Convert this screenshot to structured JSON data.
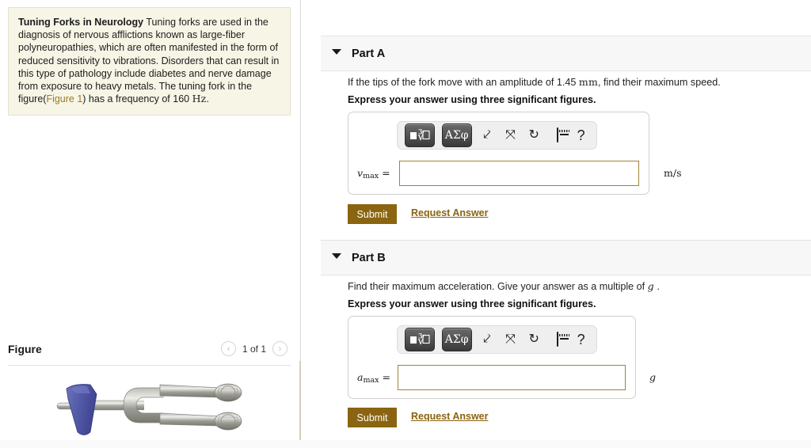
{
  "problem": {
    "title": "Tuning Forks in Neurology",
    "body_before_link": " Tuning forks are used in the diagnosis of nervous afflictions known as large-fiber polyneuropathies, which are often manifested in the form of reduced sensitivity to vibrations. Disorders that can result in this type of pathology include diabetes and nerve damage from exposure to heavy metals. The tuning fork in the figure(",
    "figure_link": "Figure 1",
    "body_after_link": ") has a frequency of 160 ",
    "frequency_unit": "Hz",
    "body_end": "."
  },
  "figure": {
    "title": "Figure",
    "count_label": "1 of 1",
    "prev_icon": "chevron-left-icon",
    "next_icon": "chevron-right-icon",
    "image_alt": "tuning fork with blue rubber handle"
  },
  "math_toolbar": {
    "template_button": "sqrt-template-icon",
    "symbols_button": "ΑΣφ",
    "undo_icon": "undo-arrow-icon",
    "redo_icon": "redo-arrow-icon",
    "reset_icon": "reset-circular-arrow-icon",
    "keyboard_icon": "keyboard-icon",
    "help_icon": "?"
  },
  "parts": [
    {
      "label": "Part A",
      "caret": "caret-down-icon",
      "question": "If the tips of the fork move with an amplitude of 1.45 mm , find their maximum speed.",
      "question_plain": "If the tips of the fork move with an amplitude of ",
      "question_value": "1.45",
      "question_unit": "mm",
      "question_tail": ", find their maximum speed.",
      "instruction": "Express your answer using three significant figures.",
      "variable": "v",
      "variable_sub": "max",
      "equals": "=",
      "input_value": "",
      "input_placeholder": "",
      "unit": "m/s",
      "unit_italic": false,
      "submit_label": "Submit",
      "request_label": "Request Answer"
    },
    {
      "label": "Part B",
      "caret": "caret-down-icon",
      "question": "Find their maximum acceleration. Give your answer as a multiple of g .",
      "question_plain": "Find their maximum acceleration. Give your answer as a multiple of ",
      "question_value": "g",
      "question_unit": "",
      "question_tail": ".",
      "instruction": "Express your answer using three significant figures.",
      "variable": "a",
      "variable_sub": "max",
      "equals": "=",
      "input_value": "",
      "input_placeholder": "",
      "unit": "g",
      "unit_italic": true,
      "submit_label": "Submit",
      "request_label": "Request Answer"
    }
  ],
  "colors": {
    "problem_background": "#f7f5e6",
    "link_gold": "#9a7d20",
    "submit_brown": "#8a6410",
    "input_border_gold": "#a08331",
    "part_header_gray": "#f7f7f7",
    "fork_handle_blue": "#5057a8",
    "fork_metal": "#9a9a96"
  }
}
